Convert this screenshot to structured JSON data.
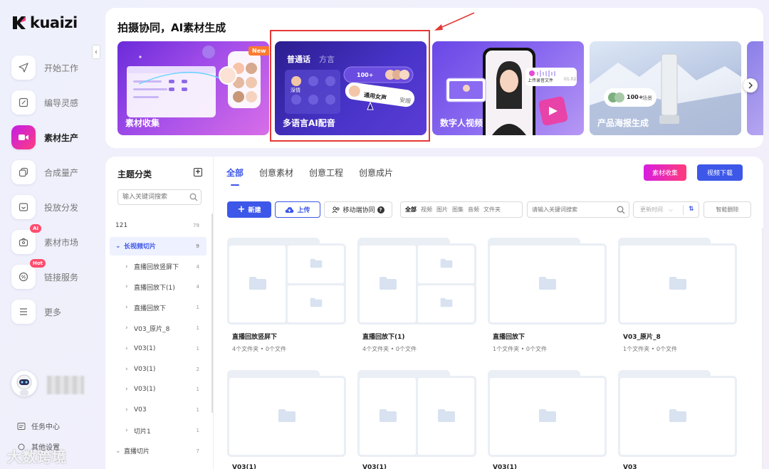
{
  "brand": {
    "name": "kuaizi"
  },
  "sidebar": {
    "items": [
      {
        "label": "开始工作",
        "icon": "send-icon",
        "active": false
      },
      {
        "label": "编导灵感",
        "icon": "edit-icon",
        "active": false
      },
      {
        "label": "素材生产",
        "icon": "video-camera-icon",
        "active": true
      },
      {
        "label": "合成量产",
        "icon": "copy-icon",
        "active": false
      },
      {
        "label": "投放分发",
        "icon": "distribute-icon",
        "active": false
      },
      {
        "label": "素材市场",
        "icon": "market-icon",
        "active": false,
        "badge": "AI"
      },
      {
        "label": "链接服务",
        "icon": "link-icon",
        "active": false,
        "badge": "Hot"
      },
      {
        "label": "更多",
        "icon": "menu-icon",
        "active": false
      }
    ],
    "task_center": "任务中心",
    "other_settings": "其他设置"
  },
  "watermark": "大数跨境",
  "banner": {
    "title": "拍摄协同，AI素材生成",
    "cards": [
      {
        "label": "素材收集",
        "badge": "New"
      },
      {
        "label": "多语言AI配音",
        "tabs": [
          "普通话",
          "方言"
        ],
        "pill_count": "100+",
        "pill_voice": "通用女声",
        "pill_voice_tag": "深情",
        "pill_side": "安顺"
      },
      {
        "label": "数字人视频",
        "pill_text": "上传录音文件",
        "pill_time": "01:02"
      },
      {
        "label": "产品海报生成",
        "pill_count": "100+",
        "pill_unit": "场景"
      }
    ]
  },
  "tree": {
    "title": "主题分类",
    "search_placeholder": "输入关键词搜索",
    "rows": [
      {
        "label": "121",
        "count": "79",
        "level": 0,
        "arrow": ""
      },
      {
        "label": "长视频切片",
        "count": "9",
        "level": 0,
        "arrow": "⌄",
        "selected": true
      },
      {
        "label": "直播回放竖屏下",
        "count": "4",
        "level": 1,
        "arrow": "›"
      },
      {
        "label": "直播回放下(1)",
        "count": "4",
        "level": 1,
        "arrow": "›"
      },
      {
        "label": "直播回放下",
        "count": "1",
        "level": 1,
        "arrow": "›"
      },
      {
        "label": "V03_原片_8",
        "count": "1",
        "level": 1,
        "arrow": "›"
      },
      {
        "label": "V03(1)",
        "count": "1",
        "level": 1,
        "arrow": "›"
      },
      {
        "label": "V03(1)",
        "count": "2",
        "level": 1,
        "arrow": "›"
      },
      {
        "label": "V03(1)",
        "count": "1",
        "level": 1,
        "arrow": "›"
      },
      {
        "label": "V03",
        "count": "1",
        "level": 1,
        "arrow": "›"
      },
      {
        "label": "切片1",
        "count": "1",
        "level": 1,
        "arrow": "›"
      },
      {
        "label": "直播切片",
        "count": "7",
        "level": 0,
        "arrow": "⌄"
      }
    ]
  },
  "tabs": [
    "全部",
    "创意素材",
    "创意工程",
    "创意成片"
  ],
  "actions": {
    "collect": "素材收集",
    "download": "视频下载",
    "new": "新建",
    "upload": "上传",
    "mobile": "移动端协同",
    "search_placeholder": "请输入关键词搜索",
    "sort": "更新时间",
    "smart_delete": "智能删除"
  },
  "filters": [
    "全部",
    "视频",
    "图片",
    "图集",
    "音频",
    "文件夹"
  ],
  "folders": [
    {
      "name": "直播回放竖屏下",
      "meta": "4个文件夹 • 0个文件",
      "layout": "split3"
    },
    {
      "name": "直播回放下(1)",
      "meta": "4个文件夹 • 0个文件",
      "layout": "split3"
    },
    {
      "name": "直播回放下",
      "meta": "1个文件夹 • 0个文件",
      "layout": "single"
    },
    {
      "name": "V03_原片_8",
      "meta": "1个文件夹 • 0个文件",
      "layout": "single"
    },
    {
      "name": "V03(1)",
      "meta": "",
      "layout": "single"
    },
    {
      "name": "V03(1)",
      "meta": "",
      "layout": "split2"
    },
    {
      "name": "V03(1)",
      "meta": "",
      "layout": "single"
    },
    {
      "name": "V03",
      "meta": "",
      "layout": "single"
    }
  ]
}
